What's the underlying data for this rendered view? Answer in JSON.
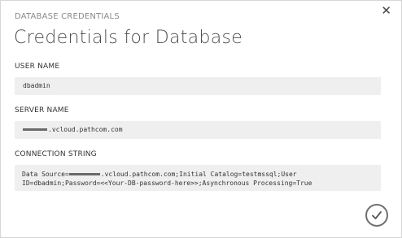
{
  "dialog": {
    "kicker": "DATABASE CREDENTIALS",
    "title": "Credentials for Database",
    "close_icon": "close-icon",
    "ok_icon": "checkmark-icon"
  },
  "fields": {
    "user_name": {
      "label": "USER NAME",
      "value": "dbadmin"
    },
    "server_name": {
      "label": "SERVER NAME",
      "value_suffix": ".vcloud.pathcom.com"
    },
    "connection_string": {
      "label": "CONNECTION STRING",
      "prefix": "Data Source=",
      "rest": ".vcloud.pathcom.com;Initial Catalog=testmssql;User ID=dbadmin;Password=<<Your-DB-password-here>>;Asynchronous Processing=True"
    }
  },
  "colors": {
    "field_bg": "#efefef",
    "text": "#333333",
    "kicker": "#8a8a8a"
  }
}
